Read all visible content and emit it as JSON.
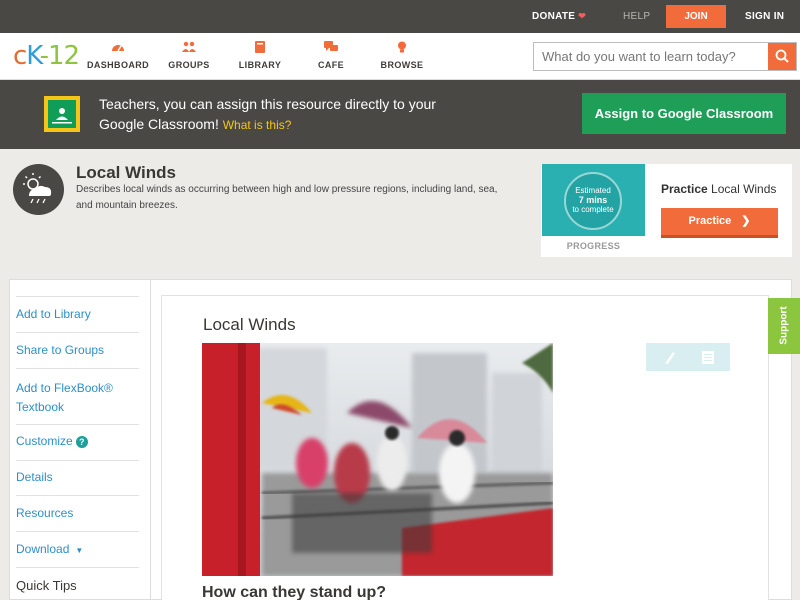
{
  "topbar": {
    "donate": "DONATE",
    "help": "HELP",
    "join": "JOIN",
    "sign_in": "SIGN IN"
  },
  "logo": {
    "c": "c",
    "k": "K",
    "dash": "-",
    "num": "12"
  },
  "nav": {
    "items": [
      {
        "label": "DASHBOARD",
        "icon": "dashboard-icon"
      },
      {
        "label": "GROUPS",
        "icon": "groups-icon"
      },
      {
        "label": "LIBRARY",
        "icon": "library-icon"
      },
      {
        "label": "CAFE",
        "icon": "cafe-icon"
      },
      {
        "label": "BROWSE",
        "icon": "browse-icon"
      }
    ],
    "search_placeholder": "What do you want to learn today?"
  },
  "banner": {
    "text": "Teachers, you can assign this resource directly to your Google Classroom!",
    "link": "What is this?",
    "button": "Assign to Google Classroom"
  },
  "concept": {
    "title": "Local Winds",
    "description": "Describes local winds as occurring between high and low pressure regions, including land, sea, and mountain breezes."
  },
  "practice": {
    "estimated": "Estimated",
    "mins": "7 mins",
    "to_complete": "to complete",
    "progress_label": "PROGRESS",
    "title_bold": "Practice",
    "title_rest": "Local Winds",
    "button": "Practice"
  },
  "sidebar": {
    "items": [
      "Add to Library",
      "Share to Groups",
      "Add to FlexBook® Textbook",
      "Customize",
      "Details",
      "Resources",
      "Download",
      "Quick Tips"
    ]
  },
  "content": {
    "title": "Local Winds",
    "subtitle": "How can they stand up?"
  },
  "support": "Support",
  "colors": {
    "accent_orange": "#f26b3a",
    "google_green": "#1e9e56",
    "link_blue": "#2d8fc9",
    "dark_bar": "#4a4844",
    "support_green": "#8cc63f"
  }
}
